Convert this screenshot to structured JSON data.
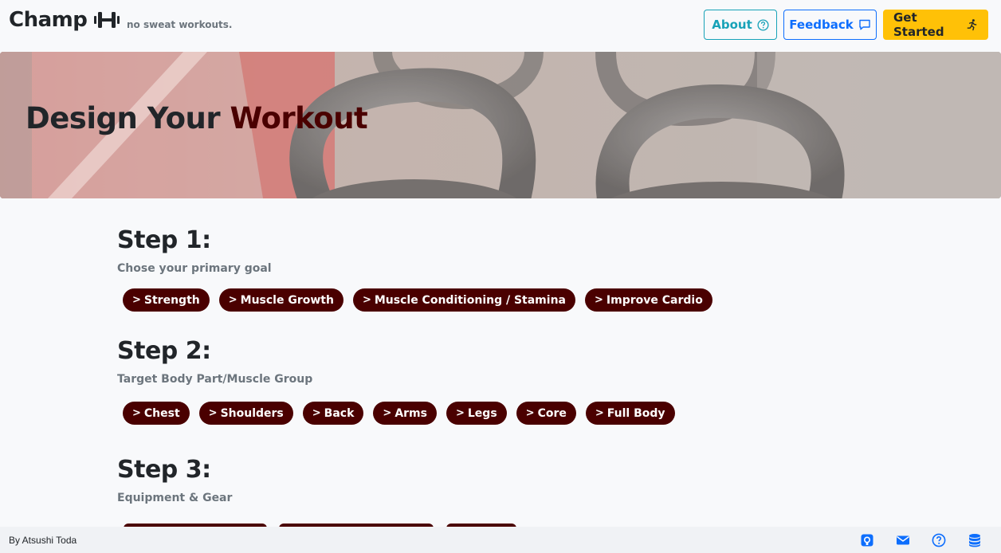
{
  "brand": {
    "name": "Champ",
    "tagline": "no sweat workouts."
  },
  "nav": {
    "about_label": "About",
    "feedback_label": "Feedback",
    "start_label": "Get Started"
  },
  "hero": {
    "title_prefix": "Design Your ",
    "title_accent": "Workout"
  },
  "steps": [
    {
      "heading": "Step 1:",
      "subtitle": "Chose your primary goal",
      "options": [
        "Strength",
        "Muscle Growth",
        "Muscle Conditioning / Stamina",
        "Improve Cardio"
      ]
    },
    {
      "heading": "Step 2:",
      "subtitle": "Target Body Part/Muscle Group",
      "options": [
        "Chest",
        "Shoulders",
        "Back",
        "Arms",
        "Legs",
        "Core",
        "Full Body"
      ]
    },
    {
      "heading": "Step 3:",
      "subtitle": "Equipment & Gear",
      "options": []
    }
  ],
  "footer": {
    "author": "By Atsushi Toda",
    "icons": [
      "github-icon",
      "mail-icon",
      "help-icon",
      "database-icon"
    ]
  },
  "colors": {
    "accent": "#4a0000",
    "about": "#17a2b8",
    "feedback": "#0d6efd",
    "start": "#ffc107"
  }
}
